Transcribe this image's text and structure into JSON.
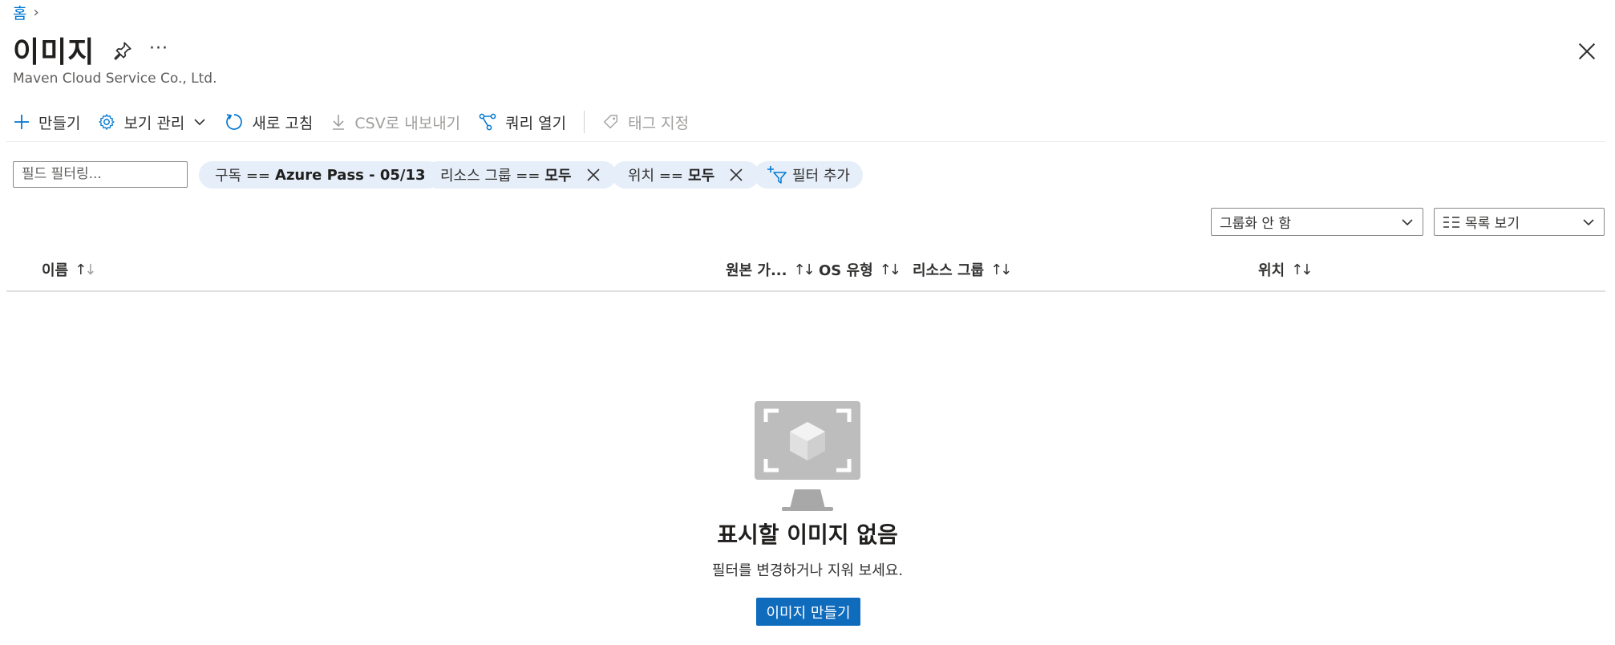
{
  "breadcrumb": {
    "home": "홈",
    "separator": "›"
  },
  "header": {
    "title": "이미지",
    "more": "···",
    "subtitle": "Maven Cloud Service Co., Ltd."
  },
  "toolbar": {
    "create": "만들기",
    "manage_view": "보기 관리",
    "refresh": "새로 고침",
    "export_csv": "CSV로 내보내기",
    "open_query": "쿼리 열기",
    "assign_tags": "태그 지정"
  },
  "filters": {
    "placeholder": "필드 필터링...",
    "subscription_label": "구독 ==",
    "subscription_value": "Azure Pass - 05/13",
    "resource_group_label": "리소스 그룹 ==",
    "resource_group_value": "모두",
    "location_label": "위치 ==",
    "location_value": "모두",
    "add_filter": "필터 추가"
  },
  "view_options": {
    "grouping": "그룹화 안 함",
    "view_mode": "목록 보기"
  },
  "table": {
    "columns": {
      "name": "이름",
      "source": "원본 가...",
      "os_type": "OS 유형",
      "resource_group": "리소스 그룹",
      "location": "위치"
    }
  },
  "empty_state": {
    "title": "표시할 이미지 없음",
    "subtitle": "필터를 변경하거나 지워 보세요.",
    "button": "이미지 만들기"
  },
  "colors": {
    "accent": "#0078d4",
    "button": "#0f6cbd",
    "pill": "#e5eef9"
  }
}
